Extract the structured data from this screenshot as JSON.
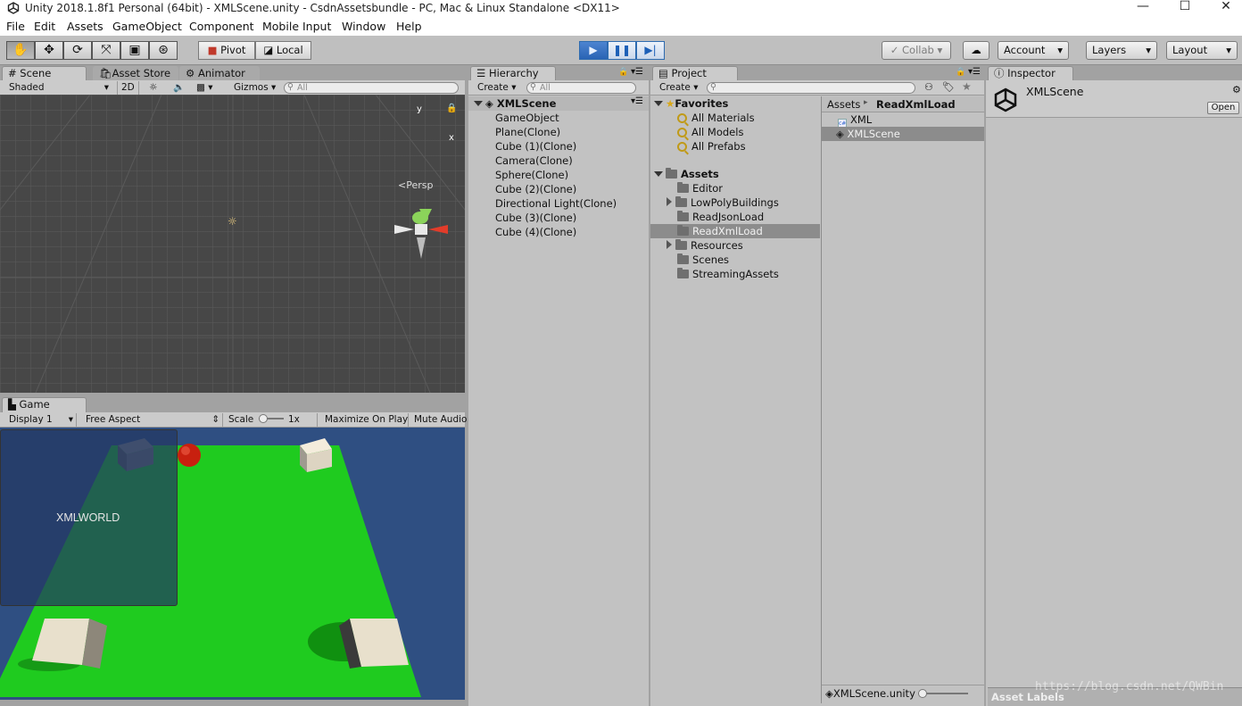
{
  "window": {
    "title": "Unity 2018.1.8f1 Personal (64bit) - XMLScene.unity - CsdnAssetsbundle - PC, Mac & Linux Standalone <DX11>",
    "minimize": "—",
    "maximize": "☐",
    "close": "✕"
  },
  "menu": [
    "File",
    "Edit",
    "Assets",
    "GameObject",
    "Component",
    "Mobile Input",
    "Window",
    "Help"
  ],
  "toolbar": {
    "pivot": "Pivot",
    "local": "Local",
    "collab": "Collab ▾",
    "account": "Account",
    "layers": "Layers",
    "layout": "Layout"
  },
  "scene": {
    "tabs": [
      "Scene",
      "Asset Store",
      "Animator"
    ],
    "shading": "Shaded",
    "mode2d": "2D",
    "gizmos": "Gizmos",
    "search_placeholder": "All",
    "persp": "Persp",
    "axis_y": "y",
    "axis_x": "x"
  },
  "game": {
    "tab": "Game",
    "display": "Display 1",
    "aspect": "Free Aspect",
    "scale_label": "Scale",
    "scale_value": "1x",
    "maximize": "Maximize On Play",
    "mute": "Mute Audio",
    "ui_text": "XMLWORLD"
  },
  "hierarchy": {
    "tab": "Hierarchy",
    "create": "Create",
    "search_placeholder": "All",
    "scene_name": "XMLScene",
    "items": [
      "GameObject",
      "Plane(Clone)",
      "Cube (1)(Clone)",
      "Camera(Clone)",
      "Sphere(Clone)",
      "Cube (2)(Clone)",
      "Directional Light(Clone)",
      "Cube (3)(Clone)",
      "Cube (4)(Clone)"
    ]
  },
  "project": {
    "tab": "Project",
    "create": "Create",
    "favorites_label": "Favorites",
    "favorites": [
      "All Materials",
      "All Models",
      "All Prefabs"
    ],
    "assets_label": "Assets",
    "folders": [
      {
        "name": "Editor",
        "expandable": false
      },
      {
        "name": "LowPolyBuildings",
        "expandable": true
      },
      {
        "name": "ReadJsonLoad",
        "expandable": false
      },
      {
        "name": "ReadXmlLoad",
        "expandable": false,
        "selected": true
      },
      {
        "name": "Resources",
        "expandable": true
      },
      {
        "name": "Scenes",
        "expandable": false
      },
      {
        "name": "StreamingAssets",
        "expandable": false
      }
    ],
    "breadcrumb_root": "Assets",
    "breadcrumb_sep": "▸",
    "breadcrumb_current": "ReadXmlLoad",
    "files": [
      {
        "name": "XML",
        "icon": "cs-script-icon"
      },
      {
        "name": "XMLScene",
        "icon": "unity-scene-icon",
        "selected": true
      }
    ],
    "footer_file": "XMLScene.unity"
  },
  "inspector": {
    "tab": "Inspector",
    "asset_name": "XMLScene",
    "open": "Open",
    "asset_labels": "Asset Labels"
  },
  "watermark": "https://blog.csdn.net/QWBin",
  "colors": {
    "play_active": "#2a64b5",
    "plane_green": "#1fcb1f",
    "sky_blue": "#2f4f82",
    "sphere_red": "#c8200f",
    "panel_gray": "#a2a2a2"
  }
}
